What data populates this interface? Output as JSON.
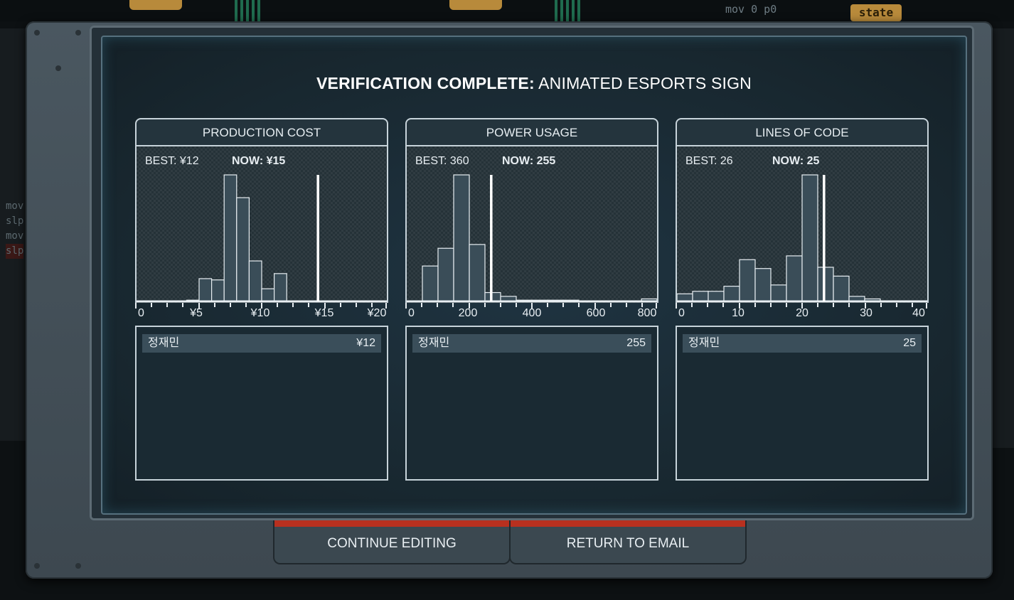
{
  "background": {
    "code_line": "mov 0 p0",
    "state_label": "state",
    "side_code": [
      "mov",
      "slp",
      "mov",
      "slp"
    ]
  },
  "dialog": {
    "title_bold": "VERIFICATION COMPLETE:",
    "title_rest": " ANIMATED ESPORTS SIGN"
  },
  "panels": [
    {
      "title": "PRODUCTION COST",
      "best": "BEST: ¥12",
      "now": "NOW: ¥15",
      "tick_labels": [
        "0",
        "¥5",
        "¥10",
        "¥15",
        "¥20"
      ],
      "entry_name": "정재민",
      "entry_value": "¥12"
    },
    {
      "title": "POWER USAGE",
      "best": "BEST: 360",
      "now": "NOW: 255",
      "tick_labels": [
        "0",
        "200",
        "400",
        "600",
        "800"
      ],
      "entry_name": "정재민",
      "entry_value": "255"
    },
    {
      "title": "LINES OF CODE",
      "best": "BEST: 26",
      "now": "NOW: 25",
      "tick_labels": [
        "0",
        "10",
        "20",
        "30",
        "40"
      ],
      "entry_name": "정재민",
      "entry_value": "25"
    }
  ],
  "buttons": {
    "continue": "CONTINUE EDITING",
    "return": "RETURN TO EMAIL"
  },
  "colors": {
    "button_accent": "#b8301f",
    "histogram_fill": "#3a4d58",
    "marker": "#ffffff"
  },
  "chart_data": [
    {
      "type": "bar",
      "title": "PRODUCTION COST",
      "xlim": [
        0,
        20
      ],
      "x_step": 1,
      "x_start": 0,
      "values": [
        0,
        0,
        0,
        0,
        1,
        18,
        17,
        100,
        82,
        32,
        10,
        22,
        0,
        0,
        0,
        0,
        0,
        0,
        0,
        0
      ],
      "marker": 14.5
    },
    {
      "type": "bar",
      "title": "POWER USAGE",
      "xlim": [
        0,
        800
      ],
      "x_step": 50,
      "x_start": 0,
      "values": [
        0,
        28,
        42,
        100,
        45,
        7,
        4,
        1,
        1,
        1,
        1,
        0,
        0,
        0,
        0,
        2
      ],
      "marker": 270
    },
    {
      "type": "bar",
      "title": "LINES OF CODE",
      "xlim": [
        0,
        40
      ],
      "x_step": 2.5,
      "x_start": 0,
      "values": [
        6,
        8,
        8,
        12,
        33,
        26,
        13,
        36,
        100,
        27,
        20,
        4,
        2,
        0,
        0,
        0
      ],
      "marker": 23.5
    }
  ]
}
